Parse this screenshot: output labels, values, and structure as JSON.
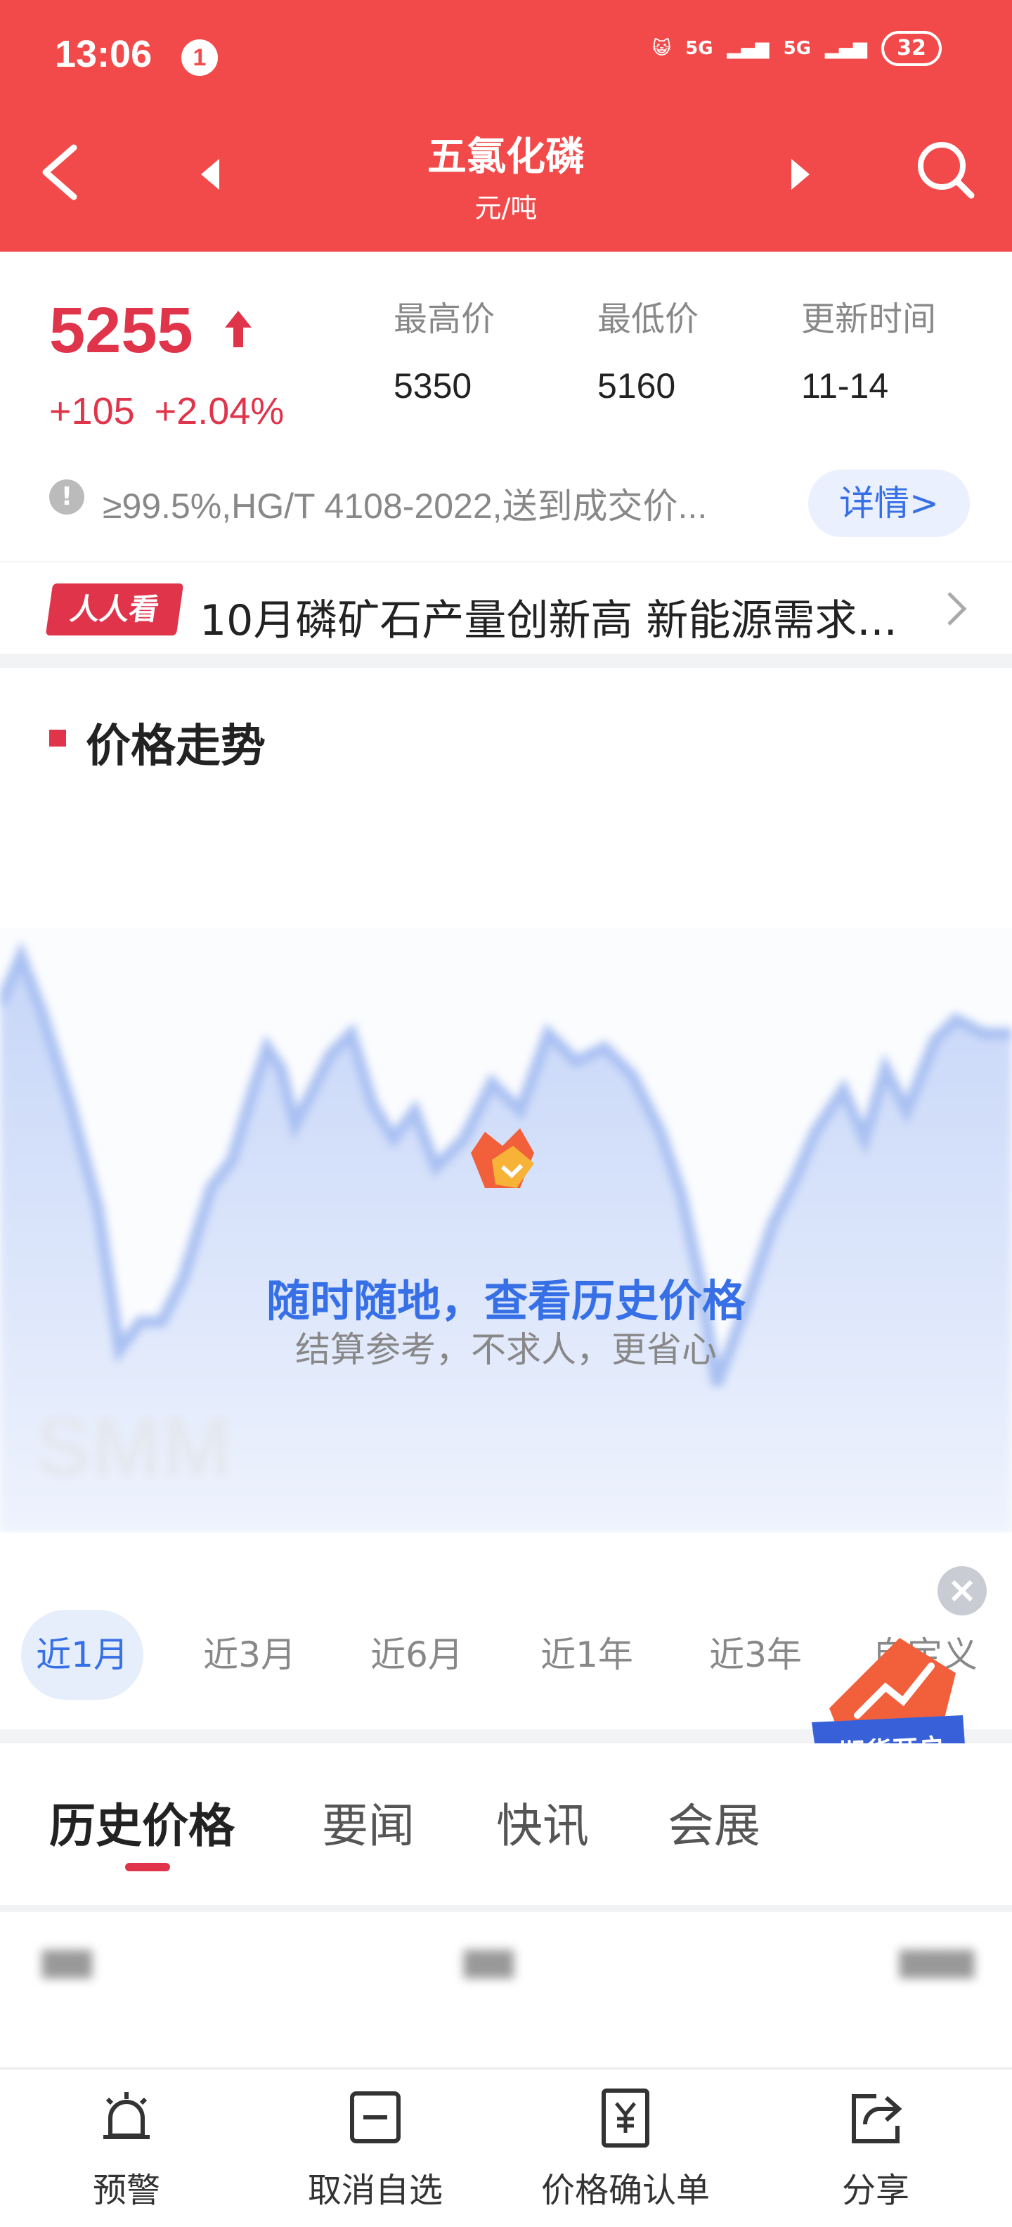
{
  "status_bar": {
    "time": "13:06",
    "notification_count": "1",
    "network_1": "5G",
    "network_2": "5G",
    "battery": "32"
  },
  "nav": {
    "title": "五氯化磷",
    "subtitle": "元/吨",
    "icons": [
      "back-icon",
      "prev-icon",
      "next-icon",
      "search-icon"
    ]
  },
  "price": {
    "current": "5255",
    "change": "+105",
    "change_pct": "+2.04%",
    "color_up": "#e0344b",
    "stats": [
      {
        "label": "最高价",
        "value": "5350"
      },
      {
        "label": "最低价",
        "value": "5160"
      },
      {
        "label": "更新时间",
        "value": "11-14"
      }
    ],
    "spec": "≥99.5%,HG/T 4108-2022,送到成交价...",
    "detail_button": "详情>"
  },
  "news": {
    "badge": "人人看",
    "headline": "10月磷矿石产量创新高 新能源需求..."
  },
  "trend": {
    "title": "价格走势",
    "promo_title": "随时随地，查看历史价格",
    "promo_subtitle": "结算参考，不求人，更省心",
    "periods": [
      "近1月",
      "近3月",
      "近6月",
      "近1年",
      "近3年",
      "自定义"
    ],
    "active_period": "近1月",
    "futures_badge": "期货开户"
  },
  "tabs": {
    "items": [
      "历史价格",
      "要闻",
      "快讯",
      "会展"
    ],
    "active": "历史价格"
  },
  "bottom_bar": {
    "items": [
      {
        "label": "预警",
        "icon": "bell-icon"
      },
      {
        "label": "取消自选",
        "icon": "minus-box-icon"
      },
      {
        "label": "价格确认单",
        "icon": "yen-doc-icon"
      },
      {
        "label": "分享",
        "icon": "share-icon"
      }
    ]
  }
}
